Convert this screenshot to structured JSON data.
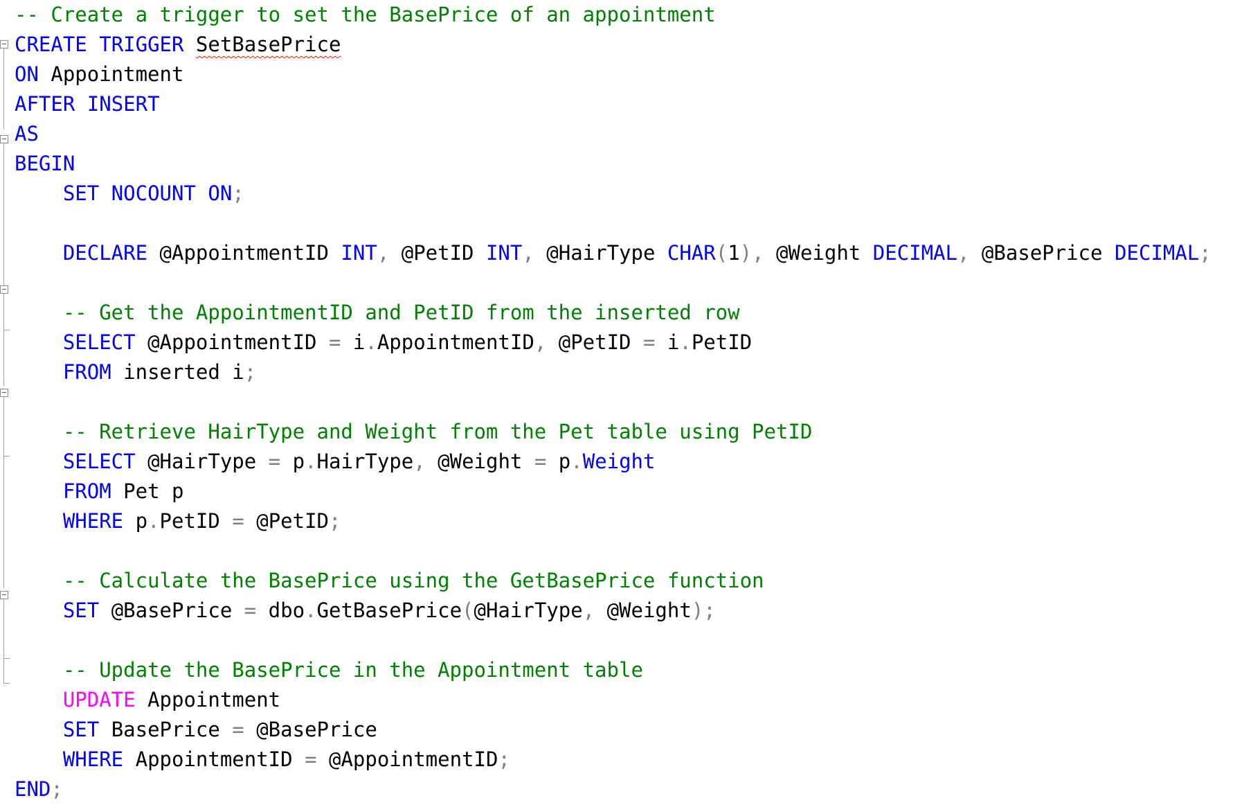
{
  "editor": {
    "colors": {
      "keyword": "#0000ff",
      "comment": "#008000",
      "dml_keyword": "#ff00ff",
      "operator": "#808080",
      "text": "#000000",
      "error_squiggle": "#e51400"
    },
    "lines": [
      [
        {
          "t": "-- Create a trigger to set the BasePrice of an appointment",
          "c": "cm"
        }
      ],
      [
        {
          "t": "CREATE",
          "c": "kw"
        },
        {
          "t": " ",
          "c": "tx"
        },
        {
          "t": "TRIGGER",
          "c": "kw"
        },
        {
          "t": " ",
          "c": "tx"
        },
        {
          "t": "SetBasePrice",
          "c": "tx",
          "err": true
        }
      ],
      [
        {
          "t": "ON",
          "c": "kw"
        },
        {
          "t": " Appointment",
          "c": "tx"
        }
      ],
      [
        {
          "t": "AFTER",
          "c": "kw"
        },
        {
          "t": " ",
          "c": "tx"
        },
        {
          "t": "INSERT",
          "c": "kw"
        }
      ],
      [
        {
          "t": "AS",
          "c": "kw"
        }
      ],
      [
        {
          "t": "BEGIN",
          "c": "kw"
        }
      ],
      [
        {
          "t": "    ",
          "c": "tx"
        },
        {
          "t": "SET",
          "c": "kw"
        },
        {
          "t": " ",
          "c": "tx"
        },
        {
          "t": "NOCOUNT",
          "c": "kw"
        },
        {
          "t": " ",
          "c": "tx"
        },
        {
          "t": "ON",
          "c": "kw"
        },
        {
          "t": ";",
          "c": "op"
        }
      ],
      [],
      [
        {
          "t": "    ",
          "c": "tx"
        },
        {
          "t": "DECLARE",
          "c": "kw"
        },
        {
          "t": " @AppointmentID ",
          "c": "tx"
        },
        {
          "t": "INT",
          "c": "kw"
        },
        {
          "t": ",",
          "c": "op"
        },
        {
          "t": " @PetID ",
          "c": "tx"
        },
        {
          "t": "INT",
          "c": "kw"
        },
        {
          "t": ",",
          "c": "op"
        },
        {
          "t": " @HairType ",
          "c": "tx"
        },
        {
          "t": "CHAR",
          "c": "kw"
        },
        {
          "t": "(",
          "c": "op"
        },
        {
          "t": "1",
          "c": "tx"
        },
        {
          "t": "),",
          "c": "op"
        },
        {
          "t": " @Weight ",
          "c": "tx"
        },
        {
          "t": "DECIMAL",
          "c": "kw"
        },
        {
          "t": ",",
          "c": "op"
        },
        {
          "t": " @BasePrice ",
          "c": "tx"
        },
        {
          "t": "DECIMAL",
          "c": "kw"
        },
        {
          "t": ";",
          "c": "op"
        }
      ],
      [],
      [
        {
          "t": "    ",
          "c": "tx"
        },
        {
          "t": "-- Get the AppointmentID and PetID from the inserted row",
          "c": "cm"
        }
      ],
      [
        {
          "t": "    ",
          "c": "tx"
        },
        {
          "t": "SELECT",
          "c": "kw"
        },
        {
          "t": " @AppointmentID ",
          "c": "tx"
        },
        {
          "t": "=",
          "c": "op"
        },
        {
          "t": " i",
          "c": "tx"
        },
        {
          "t": ".",
          "c": "op"
        },
        {
          "t": "AppointmentID",
          "c": "tx"
        },
        {
          "t": ",",
          "c": "op"
        },
        {
          "t": " @PetID ",
          "c": "tx"
        },
        {
          "t": "=",
          "c": "op"
        },
        {
          "t": " i",
          "c": "tx"
        },
        {
          "t": ".",
          "c": "op"
        },
        {
          "t": "PetID",
          "c": "tx"
        }
      ],
      [
        {
          "t": "    ",
          "c": "tx"
        },
        {
          "t": "FROM",
          "c": "kw"
        },
        {
          "t": " inserted i",
          "c": "tx"
        },
        {
          "t": ";",
          "c": "op"
        }
      ],
      [],
      [
        {
          "t": "    ",
          "c": "tx"
        },
        {
          "t": "-- Retrieve HairType and Weight from the Pet table using PetID",
          "c": "cm"
        }
      ],
      [
        {
          "t": "    ",
          "c": "tx"
        },
        {
          "t": "SELECT",
          "c": "kw"
        },
        {
          "t": " @HairType ",
          "c": "tx"
        },
        {
          "t": "=",
          "c": "op"
        },
        {
          "t": " p",
          "c": "tx"
        },
        {
          "t": ".",
          "c": "op"
        },
        {
          "t": "HairType",
          "c": "tx"
        },
        {
          "t": ",",
          "c": "op"
        },
        {
          "t": " @Weight ",
          "c": "tx"
        },
        {
          "t": "=",
          "c": "op"
        },
        {
          "t": " p",
          "c": "tx"
        },
        {
          "t": ".",
          "c": "op"
        },
        {
          "t": "Weight",
          "c": "kw"
        }
      ],
      [
        {
          "t": "    ",
          "c": "tx"
        },
        {
          "t": "FROM",
          "c": "kw"
        },
        {
          "t": " Pet p",
          "c": "tx"
        }
      ],
      [
        {
          "t": "    ",
          "c": "tx"
        },
        {
          "t": "WHERE",
          "c": "kw"
        },
        {
          "t": " p",
          "c": "tx"
        },
        {
          "t": ".",
          "c": "op"
        },
        {
          "t": "PetID ",
          "c": "tx"
        },
        {
          "t": "=",
          "c": "op"
        },
        {
          "t": " @PetID",
          "c": "tx"
        },
        {
          "t": ";",
          "c": "op"
        }
      ],
      [],
      [
        {
          "t": "    ",
          "c": "tx"
        },
        {
          "t": "-- Calculate the BasePrice using the GetBasePrice function",
          "c": "cm"
        }
      ],
      [
        {
          "t": "    ",
          "c": "tx"
        },
        {
          "t": "SET",
          "c": "kw"
        },
        {
          "t": " @BasePrice ",
          "c": "tx"
        },
        {
          "t": "=",
          "c": "op"
        },
        {
          "t": " dbo",
          "c": "tx"
        },
        {
          "t": ".",
          "c": "op"
        },
        {
          "t": "GetBasePrice",
          "c": "tx"
        },
        {
          "t": "(",
          "c": "op"
        },
        {
          "t": "@HairType",
          "c": "tx"
        },
        {
          "t": ",",
          "c": "op"
        },
        {
          "t": " @Weight",
          "c": "tx"
        },
        {
          "t": ");",
          "c": "op"
        }
      ],
      [],
      [
        {
          "t": "    ",
          "c": "tx"
        },
        {
          "t": "-- Update the BasePrice in the Appointment table",
          "c": "cm"
        }
      ],
      [
        {
          "t": "    ",
          "c": "tx"
        },
        {
          "t": "UPDATE",
          "c": "pk"
        },
        {
          "t": " Appointment",
          "c": "tx"
        }
      ],
      [
        {
          "t": "    ",
          "c": "tx"
        },
        {
          "t": "SET",
          "c": "kw"
        },
        {
          "t": " BasePrice ",
          "c": "tx"
        },
        {
          "t": "=",
          "c": "op"
        },
        {
          "t": " @BasePrice",
          "c": "tx"
        }
      ],
      [
        {
          "t": "    ",
          "c": "tx"
        },
        {
          "t": "WHERE",
          "c": "kw"
        },
        {
          "t": " AppointmentID ",
          "c": "tx"
        },
        {
          "t": "=",
          "c": "op"
        },
        {
          "t": " @AppointmentID",
          "c": "tx"
        },
        {
          "t": ";",
          "c": "op"
        }
      ],
      [
        {
          "t": "END",
          "c": "kw"
        },
        {
          "t": ";",
          "c": "op"
        }
      ]
    ]
  }
}
